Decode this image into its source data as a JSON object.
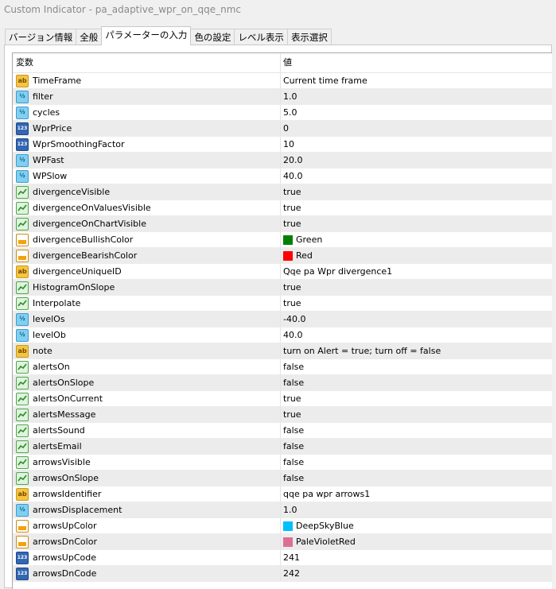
{
  "window": {
    "title": "Custom Indicator - pa_adaptive_wpr_on_qqe_nmc"
  },
  "tabs": [
    {
      "label": "バージョン情報",
      "active": false
    },
    {
      "label": "全般",
      "active": false
    },
    {
      "label": "パラメーターの入力",
      "active": true
    },
    {
      "label": "色の設定",
      "active": false
    },
    {
      "label": "レベル表示",
      "active": false
    },
    {
      "label": "表示選択",
      "active": false
    }
  ],
  "grid": {
    "headers": {
      "name": "変数",
      "value": "値"
    },
    "rows": [
      {
        "type": "string",
        "icon": "string-param-icon",
        "name": "TimeFrame",
        "value": "Current time frame"
      },
      {
        "type": "double",
        "icon": "double-param-icon",
        "name": "filter",
        "value": "1.0"
      },
      {
        "type": "double",
        "icon": "double-param-icon",
        "name": "cycles",
        "value": "5.0"
      },
      {
        "type": "int",
        "icon": "int-param-icon",
        "name": "WprPrice",
        "value": "0"
      },
      {
        "type": "int",
        "icon": "int-param-icon",
        "name": "WprSmoothingFactor",
        "value": "10"
      },
      {
        "type": "double",
        "icon": "double-param-icon",
        "name": "WPFast",
        "value": "20.0"
      },
      {
        "type": "double",
        "icon": "double-param-icon",
        "name": "WPSlow",
        "value": "40.0"
      },
      {
        "type": "bool",
        "icon": "bool-param-icon",
        "name": "divergenceVisible",
        "value": "true"
      },
      {
        "type": "bool",
        "icon": "bool-param-icon",
        "name": "divergenceOnValuesVisible",
        "value": "true"
      },
      {
        "type": "bool",
        "icon": "bool-param-icon",
        "name": "divergenceOnChartVisible",
        "value": "true"
      },
      {
        "type": "color",
        "icon": "color-param-icon",
        "name": "divergenceBullishColor",
        "value": "Green",
        "swatch": "#008000"
      },
      {
        "type": "color",
        "icon": "color-param-icon",
        "name": "divergenceBearishColor",
        "value": "Red",
        "swatch": "#ff0000"
      },
      {
        "type": "string",
        "icon": "string-param-icon",
        "name": "divergenceUniqueID",
        "value": "Qqe pa Wpr divergence1"
      },
      {
        "type": "bool",
        "icon": "bool-param-icon",
        "name": "HistogramOnSlope",
        "value": "true"
      },
      {
        "type": "bool",
        "icon": "bool-param-icon",
        "name": "Interpolate",
        "value": "true"
      },
      {
        "type": "double",
        "icon": "double-param-icon",
        "name": "levelOs",
        "value": "-40.0"
      },
      {
        "type": "double",
        "icon": "double-param-icon",
        "name": "levelOb",
        "value": "40.0"
      },
      {
        "type": "string",
        "icon": "string-param-icon",
        "name": "note",
        "value": "turn on Alert = true; turn off = false"
      },
      {
        "type": "bool",
        "icon": "bool-param-icon",
        "name": "alertsOn",
        "value": "false"
      },
      {
        "type": "bool",
        "icon": "bool-param-icon",
        "name": "alertsOnSlope",
        "value": "false"
      },
      {
        "type": "bool",
        "icon": "bool-param-icon",
        "name": "alertsOnCurrent",
        "value": "true"
      },
      {
        "type": "bool",
        "icon": "bool-param-icon",
        "name": "alertsMessage",
        "value": "true"
      },
      {
        "type": "bool",
        "icon": "bool-param-icon",
        "name": "alertsSound",
        "value": "false"
      },
      {
        "type": "bool",
        "icon": "bool-param-icon",
        "name": "alertsEmail",
        "value": "false"
      },
      {
        "type": "bool",
        "icon": "bool-param-icon",
        "name": "arrowsVisible",
        "value": "false"
      },
      {
        "type": "bool",
        "icon": "bool-param-icon",
        "name": "arrowsOnSlope",
        "value": "false"
      },
      {
        "type": "string",
        "icon": "string-param-icon",
        "name": "arrowsIdentifier",
        "value": "qqe pa wpr arrows1"
      },
      {
        "type": "double",
        "icon": "double-param-icon",
        "name": "arrowsDisplacement",
        "value": "1.0"
      },
      {
        "type": "color",
        "icon": "color-param-icon",
        "name": "arrowsUpColor",
        "value": "DeepSkyBlue",
        "swatch": "#00bfff"
      },
      {
        "type": "color",
        "icon": "color-param-icon",
        "name": "arrowsDnColor",
        "value": "PaleVioletRed",
        "swatch": "#db7093"
      },
      {
        "type": "int",
        "icon": "int-param-icon",
        "name": "arrowsUpCode",
        "value": "241"
      },
      {
        "type": "int",
        "icon": "int-param-icon",
        "name": "arrowsDnCode",
        "value": "242"
      }
    ]
  }
}
